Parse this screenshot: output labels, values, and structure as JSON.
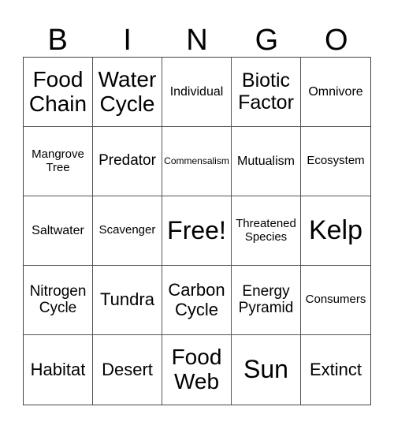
{
  "header": {
    "letters": [
      "B",
      "I",
      "N",
      "G",
      "O"
    ]
  },
  "grid": {
    "rows": [
      [
        "Food Chain",
        "Water Cycle",
        "Individual",
        "Biotic Factor",
        "Omnivore"
      ],
      [
        "Mangrove Tree",
        "Predator",
        "Commensalism",
        "Mutualism",
        "Ecosystem"
      ],
      [
        "Saltwater",
        "Scavenger",
        "Free!",
        "Threatened Species",
        "Kelp"
      ],
      [
        "Nitrogen Cycle",
        "Tundra",
        "Carbon Cycle",
        "Energy Pyramid",
        "Consumers"
      ],
      [
        "Habitat",
        "Desert",
        "Food Web",
        "Sun",
        "Extinct"
      ]
    ]
  }
}
